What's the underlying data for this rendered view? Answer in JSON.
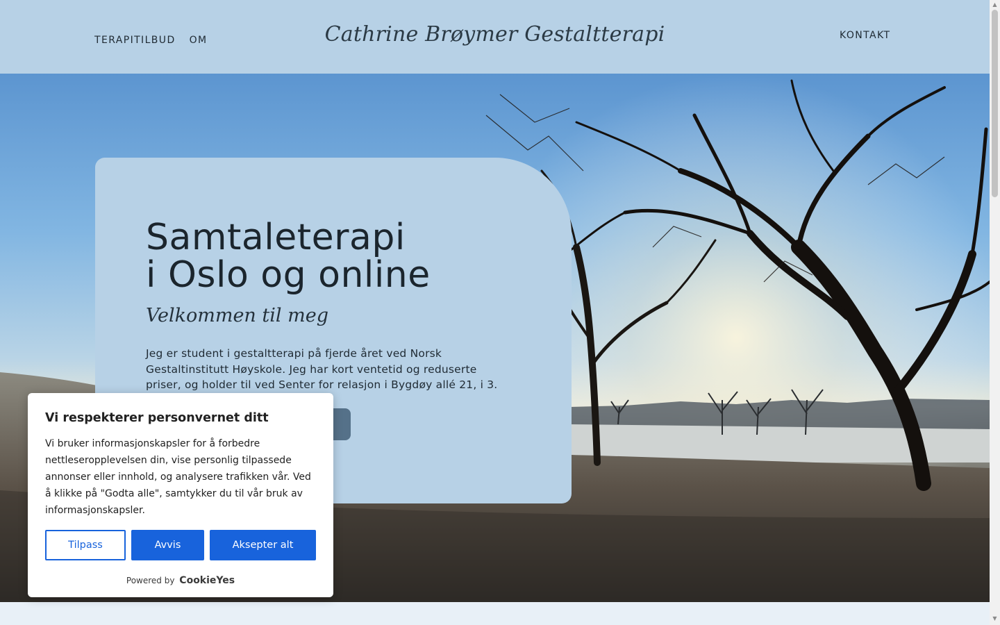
{
  "header": {
    "site_title": "Cathrine Brøymer Gestaltterapi",
    "nav_left": [
      "TERAPITILBUD",
      "OM"
    ],
    "nav_right": "KONTAKT"
  },
  "hero": {
    "title_line1": "Samtaleterapi",
    "title_line2": "i Oslo og online",
    "subtitle": "Velkommen til meg",
    "text": "Jeg er student i gestaltterapi på fjerde året ved Norsk Gestaltinstitutt Høyskole. Jeg har kort ventetid og reduserte priser, og holder til ved Senter for relasjon i Bygdøy allé 21, i 3. etasje."
  },
  "cookie": {
    "title": "Vi respekterer personvernet ditt",
    "text": "Vi bruker informasjonskapsler for å forbedre nettleseropplevelsen din, vise personlig tilpassede annonser eller innhold, og analysere trafikken vår. Ved å klikke på \"Godta alle\", samtykker du til vår bruk av informasjonskapsler.",
    "customize_label": "Tilpass",
    "reject_label": "Avvis",
    "accept_label": "Aksepter alt",
    "powered_by": "Powered by",
    "brand": "CookieYes"
  },
  "colors": {
    "header_bg": "#b7d1e6",
    "card_bg": "#b7d1e6",
    "button_bg": "#557189",
    "cookie_accent": "#1863dc"
  }
}
